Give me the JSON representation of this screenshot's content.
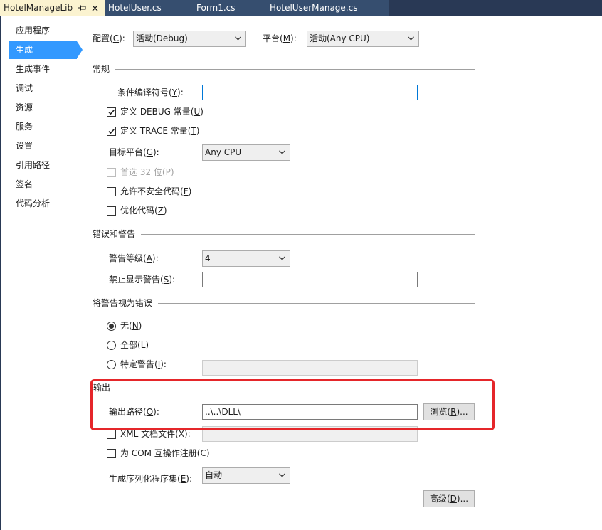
{
  "colors": {
    "tab_strip": "#293955",
    "tab_inactive": "#364E6F",
    "tab_active": "#FBF3D0",
    "accent": "#3399FF",
    "annotation_red": "#E5262A",
    "focus_border": "#0078D7"
  },
  "tabs": [
    {
      "label": "HotelManageLib",
      "active": true,
      "icons": [
        "pin-icon",
        "close-icon"
      ]
    },
    {
      "label": "HotelUser.cs",
      "active": false
    },
    {
      "label": "Form1.cs",
      "active": false
    },
    {
      "label": "HotelUserManage.cs",
      "active": false
    }
  ],
  "nav": {
    "items": [
      {
        "label": "应用程序",
        "selected": false
      },
      {
        "label": "生成",
        "selected": true
      },
      {
        "label": "生成事件",
        "selected": false
      },
      {
        "label": "调试",
        "selected": false
      },
      {
        "label": "资源",
        "selected": false
      },
      {
        "label": "服务",
        "selected": false
      },
      {
        "label": "设置",
        "selected": false
      },
      {
        "label": "引用路径",
        "selected": false
      },
      {
        "label": "签名",
        "selected": false
      },
      {
        "label": "代码分析",
        "selected": false
      }
    ]
  },
  "config_bar": {
    "configuration": {
      "label": "配置(C):",
      "value": "活动(Debug)"
    },
    "platform": {
      "label": "平台(M):",
      "value": "活动(Any CPU)"
    }
  },
  "general": {
    "header": "常规",
    "conditional_symbols": {
      "label": "条件编译符号(Y):",
      "value": "",
      "focused": true
    },
    "define_debug": {
      "label": "定义 DEBUG 常量(U)",
      "checked": true
    },
    "define_trace": {
      "label": "定义 TRACE 常量(T)",
      "checked": true
    },
    "platform_target": {
      "label": "目标平台(G):",
      "value": "Any CPU"
    },
    "prefer_32bit": {
      "label": "首选 32 位(P)",
      "checked": false,
      "disabled": true
    },
    "allow_unsafe": {
      "label": "允许不安全代码(F)",
      "checked": false
    },
    "optimize": {
      "label": "优化代码(Z)",
      "checked": false
    }
  },
  "errors_warnings": {
    "header": "错误和警告",
    "warning_level": {
      "label": "警告等级(A):",
      "value": "4"
    },
    "suppress_warnings": {
      "label": "禁止显示警告(S):",
      "value": ""
    }
  },
  "treat_warnings_as_errors": {
    "header": "将警告视为错误",
    "options": [
      {
        "label": "无(N)",
        "selected": true
      },
      {
        "label": "全部(L)",
        "selected": false
      },
      {
        "label": "特定警告(I):",
        "selected": false
      }
    ],
    "specific_warnings": {
      "value": "",
      "disabled": true
    }
  },
  "output": {
    "header": "输出",
    "output_path": {
      "label": "输出路径(O):",
      "value": "..\\..\\DLL\\"
    },
    "browse_button": "浏览(R)...",
    "xml_doc": {
      "label": "XML 文档文件(X):",
      "checked": false,
      "value": "",
      "disabled": true
    },
    "com_register": {
      "label": "为 COM 互操作注册(C)",
      "checked": false
    },
    "serialization": {
      "label": "生成序列化程序集(E):",
      "value": "自动"
    }
  },
  "advanced_button": "高级(D)..."
}
